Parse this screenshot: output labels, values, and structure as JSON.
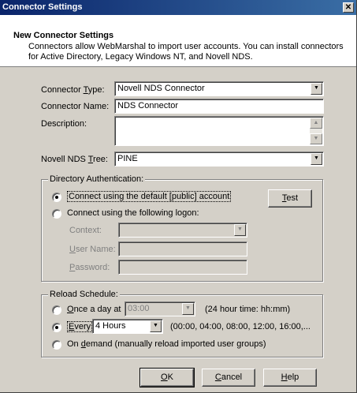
{
  "window": {
    "title": "Connector Settings",
    "close_glyph": "✕"
  },
  "header": {
    "title": "New Connector Settings",
    "description": "Connectors allow WebMarshal to import user accounts. You can install connectors for Active Directory, Legacy Windows NT, and Novell NDS."
  },
  "form": {
    "type_label_pre": "Connector ",
    "type_label_u": "T",
    "type_label_post": "ype:",
    "type_value": "Novell NDS Connector",
    "name_label": "Connector Name:",
    "name_value": "NDS Connector",
    "description_label": "Description:",
    "description_value": "",
    "tree_label_pre": "Novell NDS ",
    "tree_label_u": "T",
    "tree_label_post": "ree:",
    "tree_value": "PINE"
  },
  "auth": {
    "legend": "Directory Authentication:",
    "default_account_label": "Connect using the default [public] account",
    "default_account_selected": true,
    "logon_label": "Connect using the following logon:",
    "test_u": "T",
    "test_rest": "est",
    "context_label": "Context:",
    "context_value": "",
    "user_u": "U",
    "user_rest": "ser Name:",
    "user_value": "",
    "password_u": "P",
    "password_rest": "assword:",
    "password_value": ""
  },
  "reload": {
    "legend": "Reload Schedule:",
    "once_u": "O",
    "once_rest": "nce a day at",
    "once_time": "03:00",
    "once_hint": "(24 hour time: hh:mm)",
    "every_u": "E",
    "every_rest": "very",
    "every_value": "4 Hours",
    "every_hint": "(00:00, 04:00, 08:00, 12:00, 16:00,...",
    "demand_pre": "On ",
    "demand_u": "d",
    "demand_rest": "emand (manually reload imported user groups)",
    "selected": "every"
  },
  "buttons": {
    "ok_u": "O",
    "ok_rest": "K",
    "cancel_u": "C",
    "cancel_rest": "ancel",
    "help_u": "H",
    "help_rest": "elp"
  },
  "icons": {
    "dropdown": "chevron-down-icon",
    "scroll_up": "scroll-up-icon",
    "scroll_down": "scroll-down-icon",
    "close": "close-icon"
  }
}
